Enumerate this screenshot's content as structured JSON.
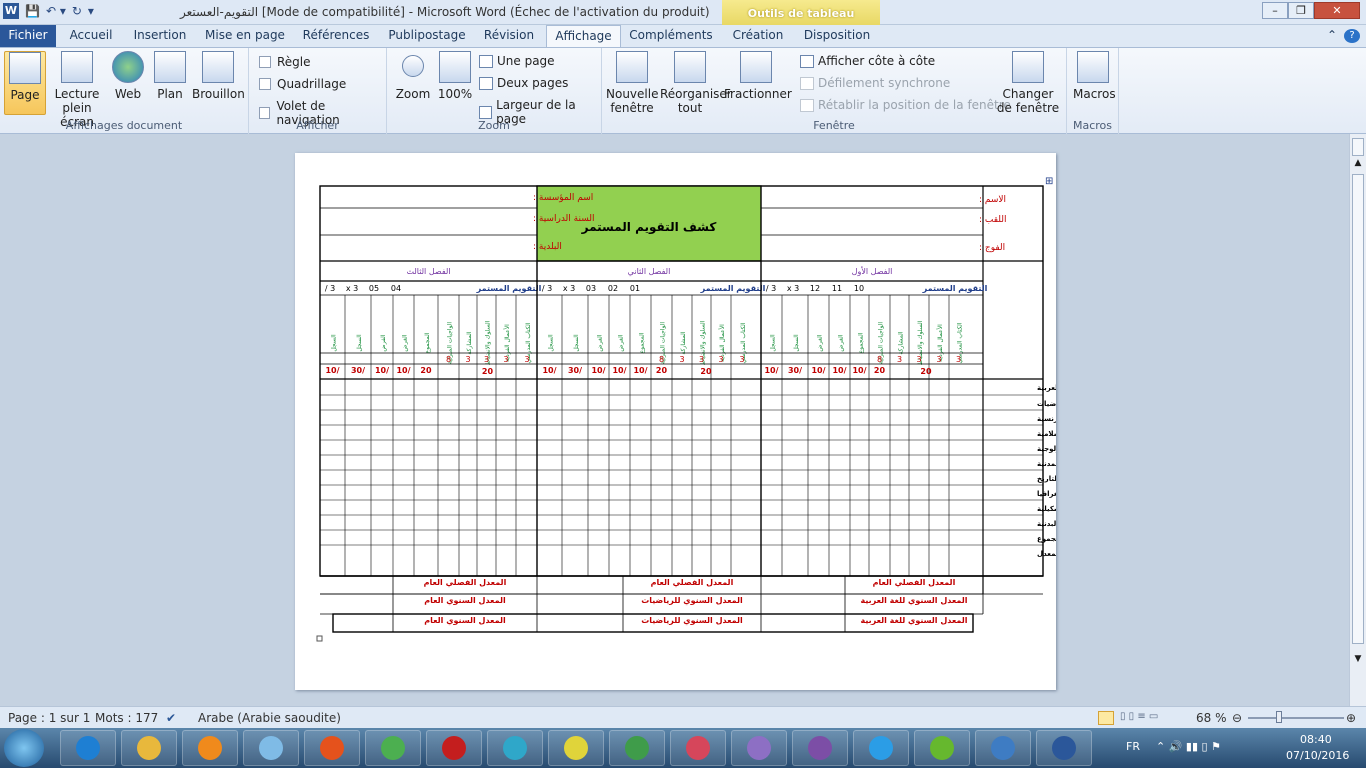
{
  "titlebar": {
    "app_icon": "W",
    "title": "التقويم-العستعر [Mode de compatibilité]  -  Microsoft Word (Échec de l'activation du produit)",
    "tool_tab": "Outils de tableau",
    "controls": [
      "–",
      "❐",
      "✕"
    ]
  },
  "tabs": [
    "Fichier",
    "Accueil",
    "Insertion",
    "Mise en page",
    "Références",
    "Publipostage",
    "Révision",
    "Affichage",
    "Compléments",
    "Création",
    "Disposition"
  ],
  "ribbon": {
    "affichages": {
      "label": "Affichages document",
      "buttons": [
        "Page",
        "Lecture plein écran",
        "Web",
        "Plan",
        "Brouillon"
      ]
    },
    "afficher": {
      "label": "Afficher",
      "checks": [
        "Règle",
        "Quadrillage",
        "Volet de navigation"
      ]
    },
    "zoom": {
      "label": "Zoom",
      "zoom_btn": "Zoom",
      "hundred": "100%",
      "small": [
        "Une page",
        "Deux pages",
        "Largeur de la page"
      ]
    },
    "fenetre": {
      "label": "Fenêtre",
      "big": [
        "Nouvelle fenêtre",
        "Réorganiser tout",
        "Fractionner"
      ],
      "small": [
        "Afficher côte à côte",
        "Défilement synchrone",
        "Rétablir la position de la fenêtre"
      ],
      "changer": "Changer de fenêtre"
    },
    "macros": {
      "label": "Macros",
      "btn": "Macros"
    }
  },
  "document": {
    "title_cell": "كشف التقويم المستمر",
    "left_labels": [
      "اسم المؤسسة :",
      "السنة الدراسية :",
      "البلدية :"
    ],
    "right_labels": [
      "الاسم :",
      "اللقب :",
      "الفوج :"
    ],
    "terms": [
      "الفصل الثالث",
      "الفصل الثاني",
      "الفصل الأول"
    ],
    "taqwim": "التقويم المستمر",
    "term_codes": [
      [
        "3 /",
        "3 x",
        "05",
        "04"
      ],
      [
        "3 /",
        "3 x",
        "03",
        "02",
        "01"
      ],
      [
        "3 /",
        "3 x",
        "12",
        "11",
        "10"
      ]
    ],
    "col_headers": [
      "السجل",
      "السجل",
      "الفرض",
      "الفرض",
      "المجموع",
      "الواجبات المنزلية",
      "المشاركة",
      "السلوك والانضباط",
      "الأعمال الفردية",
      "الكتاب المدرسي"
    ],
    "max_points": [
      "8",
      "3",
      "3",
      "3",
      "3"
    ],
    "sub_total": "20",
    "denominators": [
      "/10",
      "/30",
      "/10",
      "/10",
      "20"
    ],
    "denominators_mid": [
      "/10",
      "/30",
      "/10",
      "/10",
      "/10",
      "20"
    ],
    "subjects": [
      "اللغة العربية",
      "الرياضيات",
      "لغة فرنسية",
      "تربية إسلامية",
      "ت ع وتكنولوجية",
      "التربية المدنية",
      "التاريخ",
      "الجغرافيا",
      "التربية التشكيلية",
      "التربية البدنية",
      "المجموع",
      "المعدل"
    ],
    "footer_row1": [
      "المعدل الفصلي العام",
      "المعدل الفصلي العام",
      "المعدل الفصلي العام"
    ],
    "footer_row2": [
      "المعدل السنوي العام",
      "المعدل السنوي للرياضيات",
      "المعدل السنوي للغة العربية"
    ],
    "footer_row3": [
      "المعدل السنوي العام",
      "المعدل السنوي للرياضيات",
      "المعدل السنوي للغة العربية"
    ]
  },
  "status": {
    "page": "Page : 1 sur 1",
    "words": "Mots : 177",
    "lang": "Arabe (Arabie saoudite)",
    "zoom": "68 %"
  },
  "tray": {
    "lang": "FR",
    "time": "08:40",
    "date": "07/10/2016"
  },
  "taskbar_apps": [
    "start-orb",
    "internet-explorer",
    "file-explorer",
    "media-player",
    "notepad",
    "firefox",
    "chrome",
    "opera",
    "video",
    "vivaldi",
    "camtasia",
    "picasa",
    "dictionary",
    "onenote",
    "sync",
    "utorrent",
    "browser",
    "word"
  ],
  "colors": {
    "header_green": "#92d050",
    "red": "#c00000",
    "blue": "#1f3d8a",
    "green": "#1a8f3c",
    "purple": "#7030a0"
  }
}
